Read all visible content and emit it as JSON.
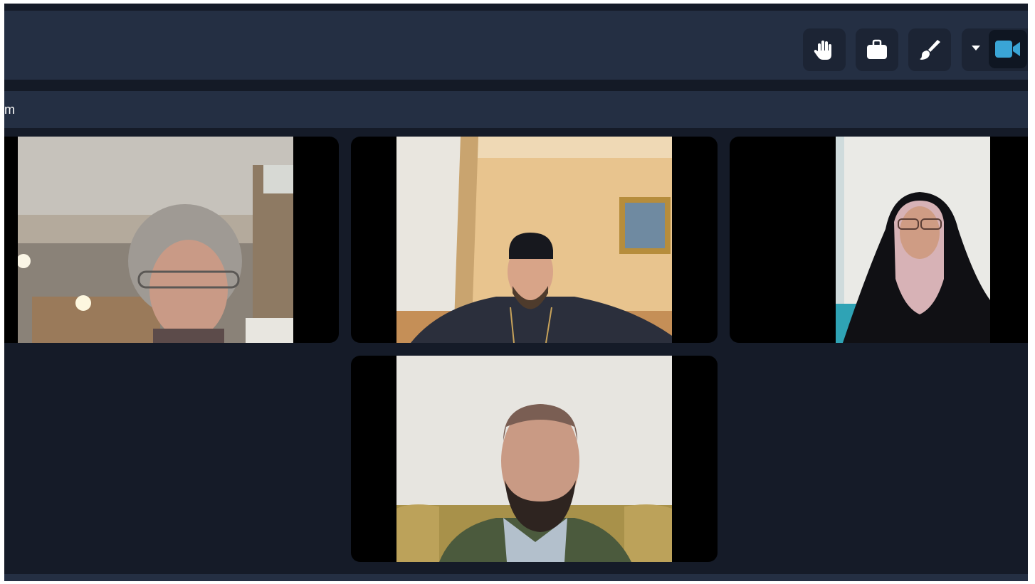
{
  "toolbar": {
    "buttons": [
      {
        "name": "raise-hand",
        "icon": "hand-icon"
      },
      {
        "name": "share",
        "icon": "briefcase-icon"
      },
      {
        "name": "whiteboard",
        "icon": "paintbrush-icon"
      },
      {
        "name": "video-options",
        "icon": "chevron-down-icon"
      },
      {
        "name": "video",
        "icon": "video-camera-icon",
        "color": "#3aa5d6"
      }
    ]
  },
  "meeting_header": {
    "text": "m"
  },
  "participants": [
    {
      "position": "top-left",
      "video": "woman-grey-hair-glasses"
    },
    {
      "position": "top-center",
      "video": "man-black-cassock"
    },
    {
      "position": "top-right",
      "video": "woman-black-hijab"
    },
    {
      "position": "bottom-center",
      "video": "man-beard-sofa"
    }
  ],
  "colors": {
    "app_background": "#151b28",
    "bar_background": "#242f43",
    "button_background": "#1c2434",
    "video_accent": "#3aa5d6"
  }
}
